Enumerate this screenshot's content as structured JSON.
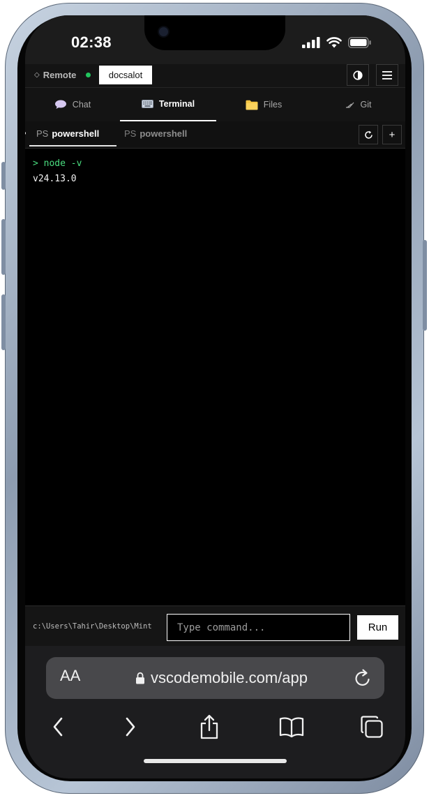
{
  "status_bar": {
    "time": "02:38"
  },
  "header": {
    "remote_label": "Remote",
    "project_name": "docsalot"
  },
  "tabs": [
    {
      "label": "Chat",
      "icon": "chat-bubble-icon"
    },
    {
      "label": "Terminal",
      "icon": "keyboard-icon",
      "active": true
    },
    {
      "label": "Files",
      "icon": "folder-icon"
    },
    {
      "label": "Git",
      "icon": "git-branch-icon"
    }
  ],
  "terminal_tabs": [
    {
      "prefix": "PS",
      "name": "powershell",
      "active": true
    },
    {
      "prefix": "PS",
      "name": "powershell",
      "active": false
    }
  ],
  "terminal": {
    "command_line": "> node -v",
    "output_line": "v24.13.0"
  },
  "command_bar": {
    "cwd": "c:\\Users\\Tahir\\Desktop\\Mint",
    "input_placeholder": "Type command...",
    "run_label": "Run"
  },
  "browser": {
    "aa_label": "AA",
    "url": "vscodemobile.com/app"
  },
  "colors": {
    "accent_green": "#22c55e",
    "terminal_command": "#4ade80",
    "folder": "#f5c542"
  }
}
